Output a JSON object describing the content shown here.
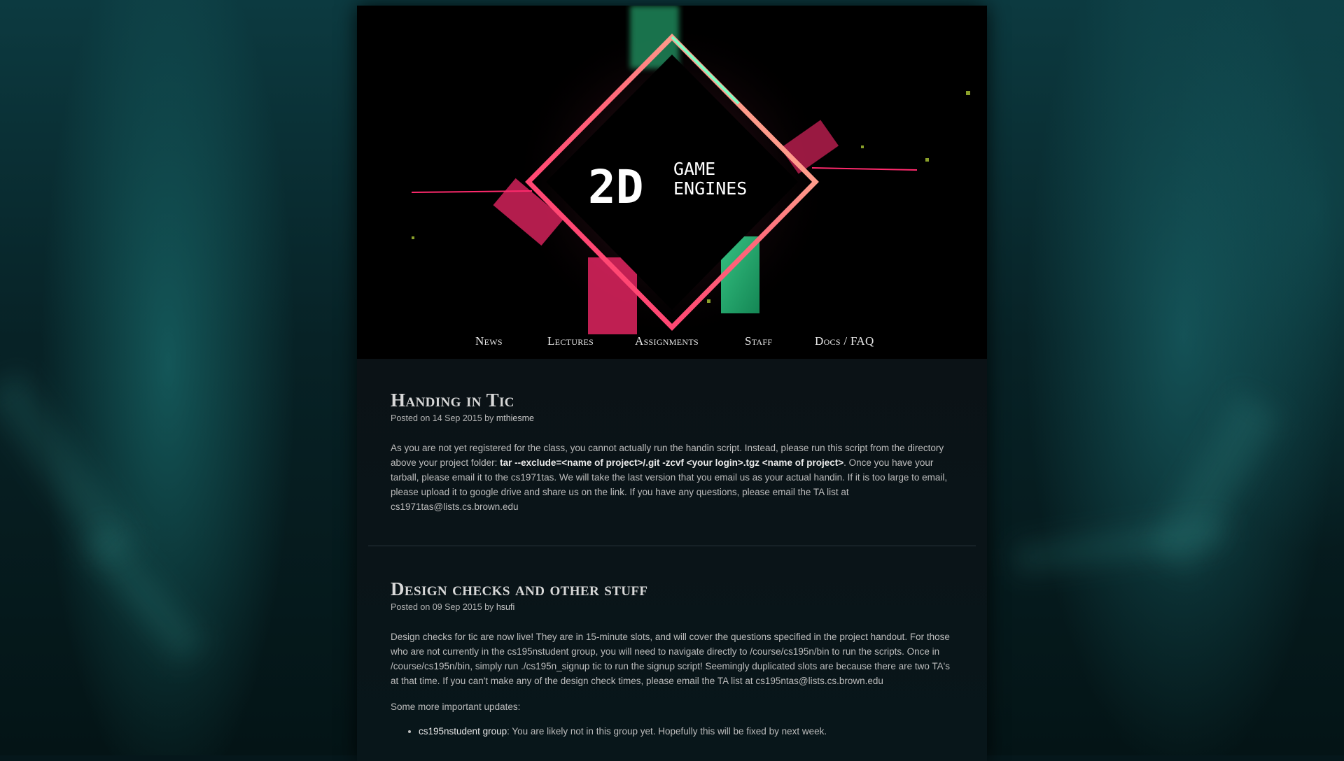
{
  "logo": {
    "text_big": "2D",
    "text_top": "GAME",
    "text_bottom": "ENGINES"
  },
  "nav": {
    "items": [
      {
        "label": "News"
      },
      {
        "label": "Lectures"
      },
      {
        "label": "Assignments"
      },
      {
        "label": "Staff"
      },
      {
        "label": "Docs / FAQ"
      }
    ]
  },
  "posts": [
    {
      "title": "Handing in Tic",
      "meta_prefix": "Posted on 14 Sep 2015 by ",
      "author": "mthiesme",
      "body_1": "As you are not yet registered for the class, you cannot actually run the handin script. Instead, please run this script from the directory above your project folder: ",
      "command": "tar --exclude=<name of project>/.git -zcvf <your login>.tgz <name of project>",
      "body_2": ". Once you have your tarball, please email it to the cs1971tas. We will take the last version that you email us as your actual handin. If it is too large to email, please upload it to google drive and share us on the link. If you have any questions, please email the TA list at cs1971tas@lists.cs.brown.edu"
    },
    {
      "title": "Design checks and other stuff",
      "meta_prefix": "Posted on 09 Sep 2015 by ",
      "author": "hsufi",
      "body": "Design checks for tic are now live! They are in 15-minute slots, and will cover the questions specified in the project handout. For those who are not currently in the cs195nstudent group, you will need to navigate directly to /course/cs195n/bin to run the scripts. Once in /course/cs195n/bin, simply run ./cs195n_signup tic to run the signup script! Seemingly duplicated slots are because there are two TA's at that time. If you can't make any of the design check times, please email the TA list at cs195ntas@lists.cs.brown.edu",
      "updates_intro": "Some more important updates:",
      "updates": [
        {
          "term": "cs195nstudent group",
          "text": ": You are likely not in this group yet. Hopefully this will be fixed by next week."
        }
      ]
    }
  ],
  "colors": {
    "accent_pink": "#ff2a6d",
    "accent_green": "#3ef0a0",
    "page_bg": "#05171b",
    "panel_bg": "#000000"
  }
}
